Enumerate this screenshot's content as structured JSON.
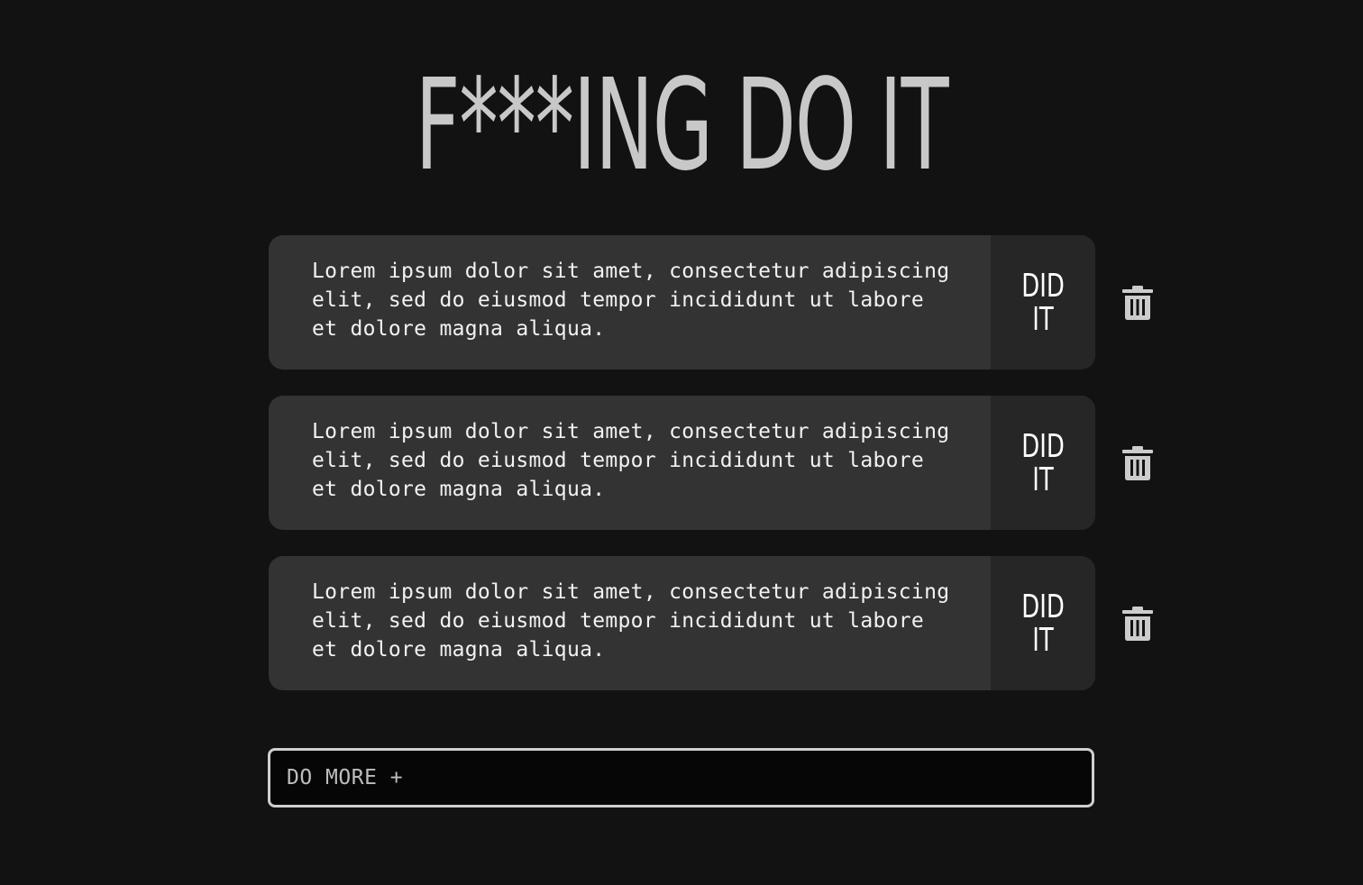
{
  "header": {
    "title": "F***ING DO IT"
  },
  "tasks": [
    {
      "text": "Lorem ipsum dolor sit amet, consectetur adipiscing\nelit, sed do eiusmod tempor incididunt ut labore\net dolore magna aliqua.",
      "done_label": "DID\nIT",
      "delete_icon": "trash-icon"
    },
    {
      "text": "Lorem ipsum dolor sit amet, consectetur adipiscing\nelit, sed do eiusmod tempor incididunt ut labore\net dolore magna aliqua.",
      "done_label": "DID\nIT",
      "delete_icon": "trash-icon"
    },
    {
      "text": "Lorem ipsum dolor sit amet, consectetur adipiscing\nelit, sed do eiusmod tempor incididunt ut labore\net dolore magna aliqua.",
      "done_label": "DID\nIT",
      "delete_icon": "trash-icon"
    }
  ],
  "add_task": {
    "placeholder": "DO MORE +"
  },
  "colors": {
    "background": "#121212",
    "card": "#333333",
    "done_button": "#262626",
    "title": "#c8c8c8",
    "icon": "#cccccc"
  }
}
